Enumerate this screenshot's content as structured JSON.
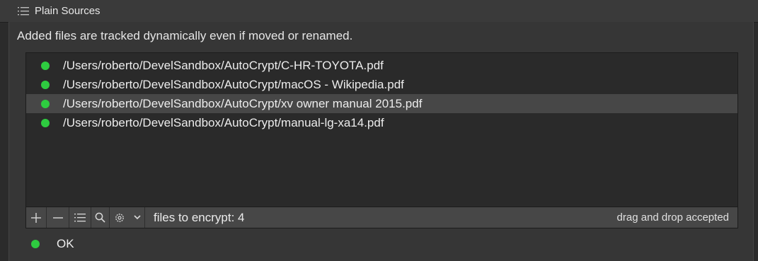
{
  "header": {
    "title": "Plain Sources",
    "icon": "list-icon"
  },
  "description": "Added files are tracked dynamically  even if moved or renamed.",
  "files": [
    {
      "path": "/Users/roberto/DevelSandbox/AutoCrypt/C-HR-TOYOTA.pdf",
      "selected": false
    },
    {
      "path": "/Users/roberto/DevelSandbox/AutoCrypt/macOS - Wikipedia.pdf",
      "selected": false
    },
    {
      "path": "/Users/roberto/DevelSandbox/AutoCrypt/xv owner manual 2015.pdf",
      "selected": true
    },
    {
      "path": "/Users/roberto/DevelSandbox/AutoCrypt/manual-lg-xa14.pdf",
      "selected": false
    }
  ],
  "toolbar": {
    "buttons": [
      "plus-icon",
      "minus-icon",
      "list-icon",
      "search-icon",
      "gear-icon",
      "chevron-down-icon"
    ],
    "count_label": "files to encrypt: 4",
    "drop_label": "drag and drop accepted"
  },
  "status": {
    "text": "OK"
  },
  "colors": {
    "ok_green": "#2ecc40",
    "selection": "#474747"
  }
}
